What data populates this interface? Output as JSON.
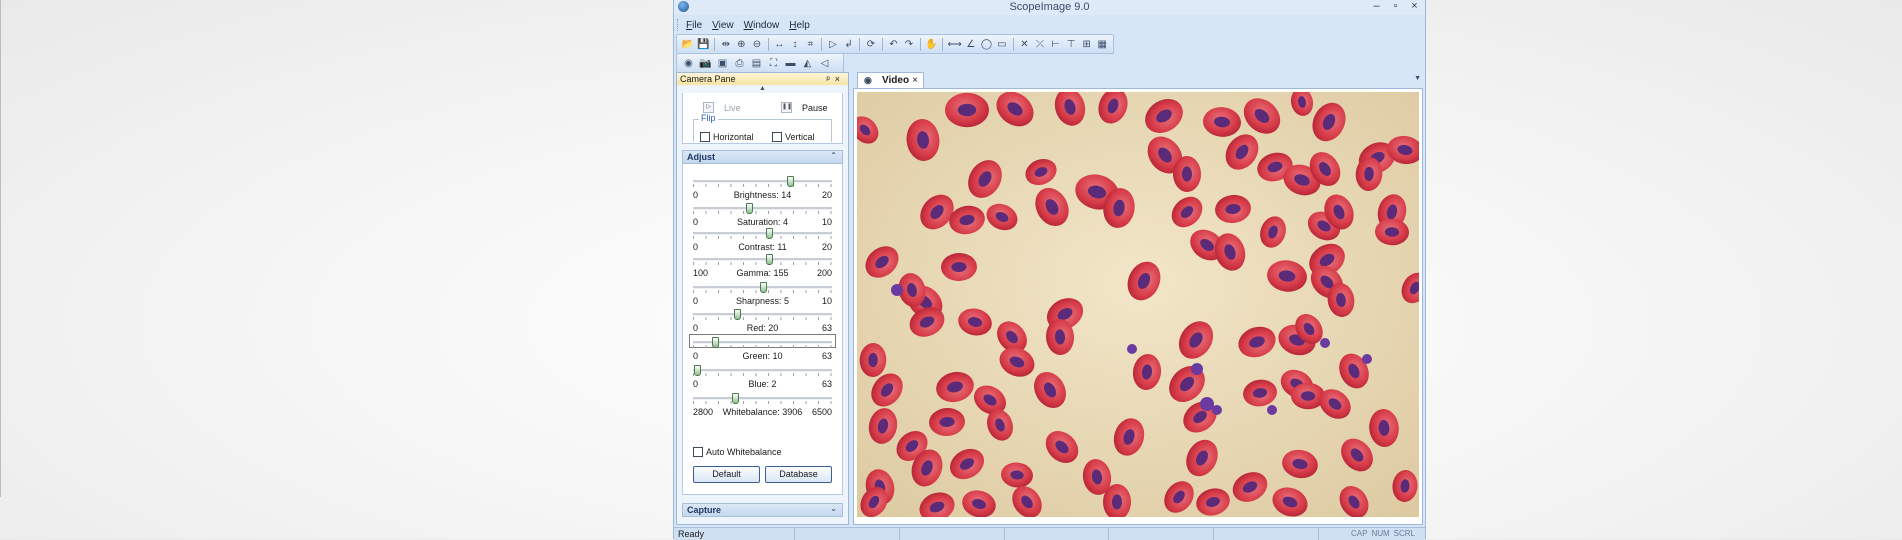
{
  "window": {
    "title": "ScopeImage 9.0",
    "controls": [
      "–",
      "▫",
      "×"
    ]
  },
  "menu": [
    {
      "prefix": "",
      "u": "F",
      "rest": "ile"
    },
    {
      "prefix": "",
      "u": "V",
      "rest": "iew"
    },
    {
      "prefix": "",
      "u": "W",
      "rest": "indow"
    },
    {
      "prefix": "",
      "u": "H",
      "rest": "elp"
    }
  ],
  "pane": {
    "title": "Camera Pane",
    "pin_glyph": "ᵖ",
    "close_glyph": "×",
    "live_label": "Live",
    "pause_label": "Pause",
    "flip_label": "Flip",
    "horizontal_label": "Horizontal",
    "vertical_label": "Vertical",
    "adjust_title": "Adjust",
    "auto_wb_label": "Auto Whitebalance",
    "default_btn": "Default",
    "database_btn": "Database",
    "capture_title": "Capture"
  },
  "sliders": [
    {
      "name": "Brightness",
      "min": "0",
      "max": "20",
      "value": 14,
      "min_n": 0,
      "max_n": 20
    },
    {
      "name": "Saturation",
      "min": "0",
      "max": "10",
      "value": 4,
      "min_n": 0,
      "max_n": 10
    },
    {
      "name": "Contrast",
      "min": "0",
      "max": "20",
      "value": 11,
      "min_n": 0,
      "max_n": 20
    },
    {
      "name": "Gamma",
      "min": "100",
      "max": "200",
      "value": 155,
      "min_n": 100,
      "max_n": 200
    },
    {
      "name": "Sharpness",
      "min": "0",
      "max": "10",
      "value": 5,
      "min_n": 0,
      "max_n": 10
    },
    {
      "name": "Red",
      "min": "0",
      "max": "63",
      "value": 20,
      "min_n": 0,
      "max_n": 63
    },
    {
      "name": "Green",
      "min": "0",
      "max": "63",
      "value": 10,
      "min_n": 0,
      "max_n": 63
    },
    {
      "name": "Blue",
      "min": "0",
      "max": "63",
      "value": 2,
      "min_n": 0,
      "max_n": 63
    },
    {
      "name": "Whitebalance",
      "min": "2800",
      "max": "6500",
      "value": 3906,
      "min_n": 2800,
      "max_n": 6500
    }
  ],
  "slider_text": [
    "Brightness: 14",
    "Saturation: 4",
    "Contrast: 11",
    "Gamma: 155",
    "Sharpness: 5",
    "Red: 20",
    "Green: 10",
    "Blue: 2",
    "Whitebalance: 3906"
  ],
  "document": {
    "tab_label": "Video",
    "tab_close": "×"
  },
  "status": {
    "text": "Ready",
    "indicators": [
      "CAP",
      "NUM",
      "SCRL"
    ]
  },
  "colors": {
    "app_bg": "#d6e6f7",
    "pane_title": "#f6e3a4",
    "cell_red": "#d63a47",
    "cell_nucleus": "#5b2a78",
    "slide_bg": "#e6d7b4"
  }
}
